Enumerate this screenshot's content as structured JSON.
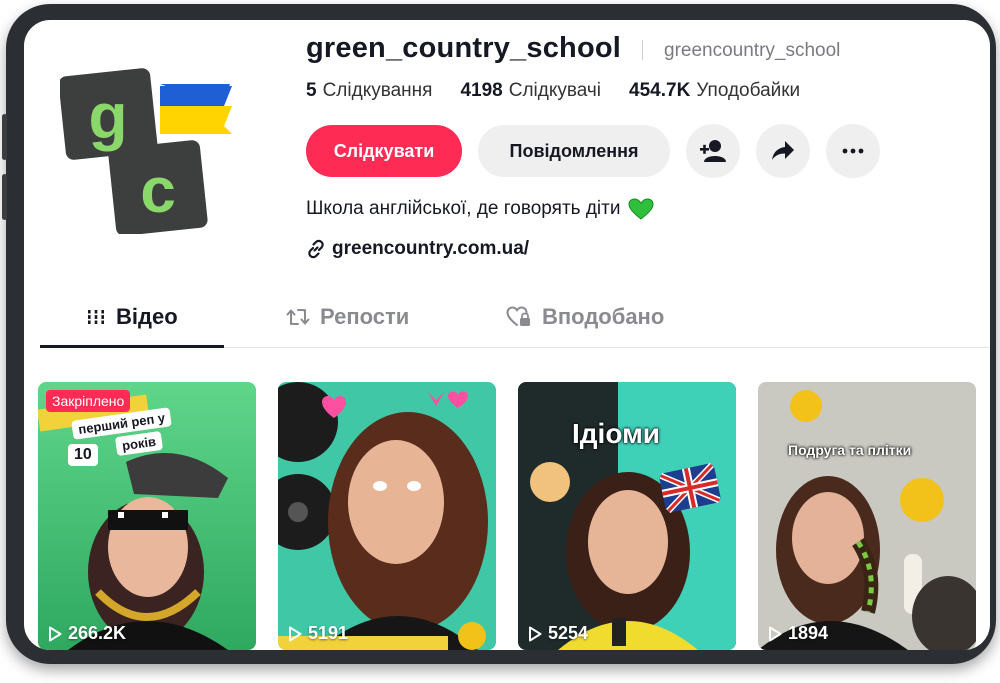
{
  "profile": {
    "username": "green_country_school",
    "nickname": "greencountry_school",
    "avatar_text_top": "g",
    "avatar_text_bottom": "c",
    "bio": "Школа англійської, де говорять діти",
    "link": "greencountry.com.ua/"
  },
  "stats": [
    {
      "value": "5",
      "label": "Слідкування"
    },
    {
      "value": "4198",
      "label": "Слідкувачі"
    },
    {
      "value": "454.7K",
      "label": "Уподобайки"
    }
  ],
  "actions": {
    "follow_label": "Слідкувати",
    "message_label": "Повідомлення"
  },
  "tabs": [
    {
      "label": "Відео",
      "icon": "grid-icon",
      "active": true
    },
    {
      "label": "Репости",
      "icon": "repost-icon",
      "active": false
    },
    {
      "label": "Вподобано",
      "icon": "heart-lock-icon",
      "active": false
    }
  ],
  "videos": [
    {
      "views": "266.2K",
      "pinned_label": "Закріплено",
      "caption_lines": [
        "перший реп у",
        "10",
        "років"
      ]
    },
    {
      "views": "5191"
    },
    {
      "views": "5254",
      "caption": "Ідіоми"
    },
    {
      "views": "1894",
      "caption": "Подруга та плітки"
    }
  ],
  "colors": {
    "accent": "#fe2c55",
    "brand_green": "#8bd86a",
    "brand_dark": "#3c3f3d",
    "flag_blue": "#1f5fd6",
    "flag_yellow": "#ffd400"
  }
}
